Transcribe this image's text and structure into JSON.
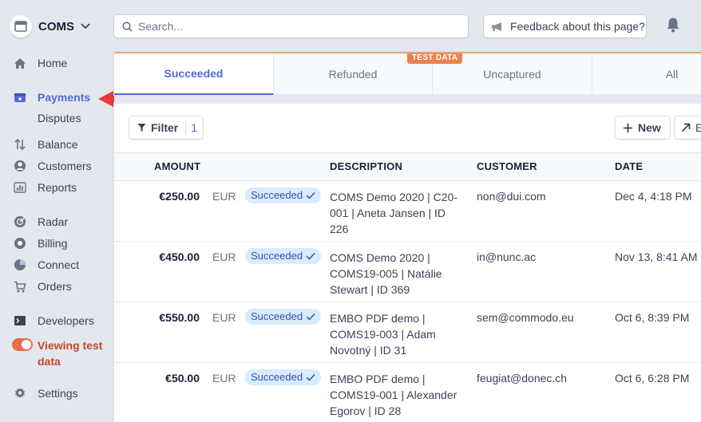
{
  "org": {
    "name": "COMS"
  },
  "search": {
    "placeholder": "Search..."
  },
  "feedback": {
    "label": "Feedback about this page?"
  },
  "nav": {
    "home": "Home",
    "payments": "Payments",
    "disputes": "Disputes",
    "balance": "Balance",
    "customers": "Customers",
    "reports": "Reports",
    "radar": "Radar",
    "billing": "Billing",
    "connect": "Connect",
    "orders": "Orders",
    "developers": "Developers",
    "viewing_test_data": "Viewing test data",
    "settings": "Settings"
  },
  "tabs": [
    {
      "label": "Succeeded"
    },
    {
      "label": "Refunded"
    },
    {
      "label": "Uncaptured"
    },
    {
      "label": "All"
    }
  ],
  "test_badge": "TEST DATA",
  "toolbar": {
    "filter_label": "Filter",
    "filter_count": "1",
    "new_label": "New",
    "export_label": "E"
  },
  "table": {
    "headers": {
      "amount": "AMOUNT",
      "description": "DESCRIPTION",
      "customer": "CUSTOMER",
      "date": "DATE"
    },
    "rows": [
      {
        "amount": "€250.00",
        "currency": "EUR",
        "status": "Succeeded",
        "description": "COMS Demo 2020 | C20-001 | Aneta Jansen | ID 226",
        "customer": "non@dui.com",
        "date": "Dec 4, 4:18 PM"
      },
      {
        "amount": "€450.00",
        "currency": "EUR",
        "status": "Succeeded",
        "description": "COMS Demo 2020 | COMS19-005 | Natálie Stewart | ID 369",
        "customer": "in@nunc.ac",
        "date": "Nov 13, 8:41 AM"
      },
      {
        "amount": "€550.00",
        "currency": "EUR",
        "status": "Succeeded",
        "description": "EMBO PDF demo | COMS19-003 | Adam Novotný | ID 31",
        "customer": "sem@commodo.eu",
        "date": "Oct 6, 8:39 PM"
      },
      {
        "amount": "€50.00",
        "currency": "EUR",
        "status": "Succeeded",
        "description": "EMBO PDF demo | COMS19-001 | Alexander Egorov | ID 28",
        "customer": "feugiat@donec.ch",
        "date": "Oct 6, 6:28 PM"
      }
    ]
  },
  "colors": {
    "accent": "#5469d4",
    "test_mode": "#e56f4a",
    "badge_bg": "#d6ecff",
    "arrow": "#e8383c"
  }
}
